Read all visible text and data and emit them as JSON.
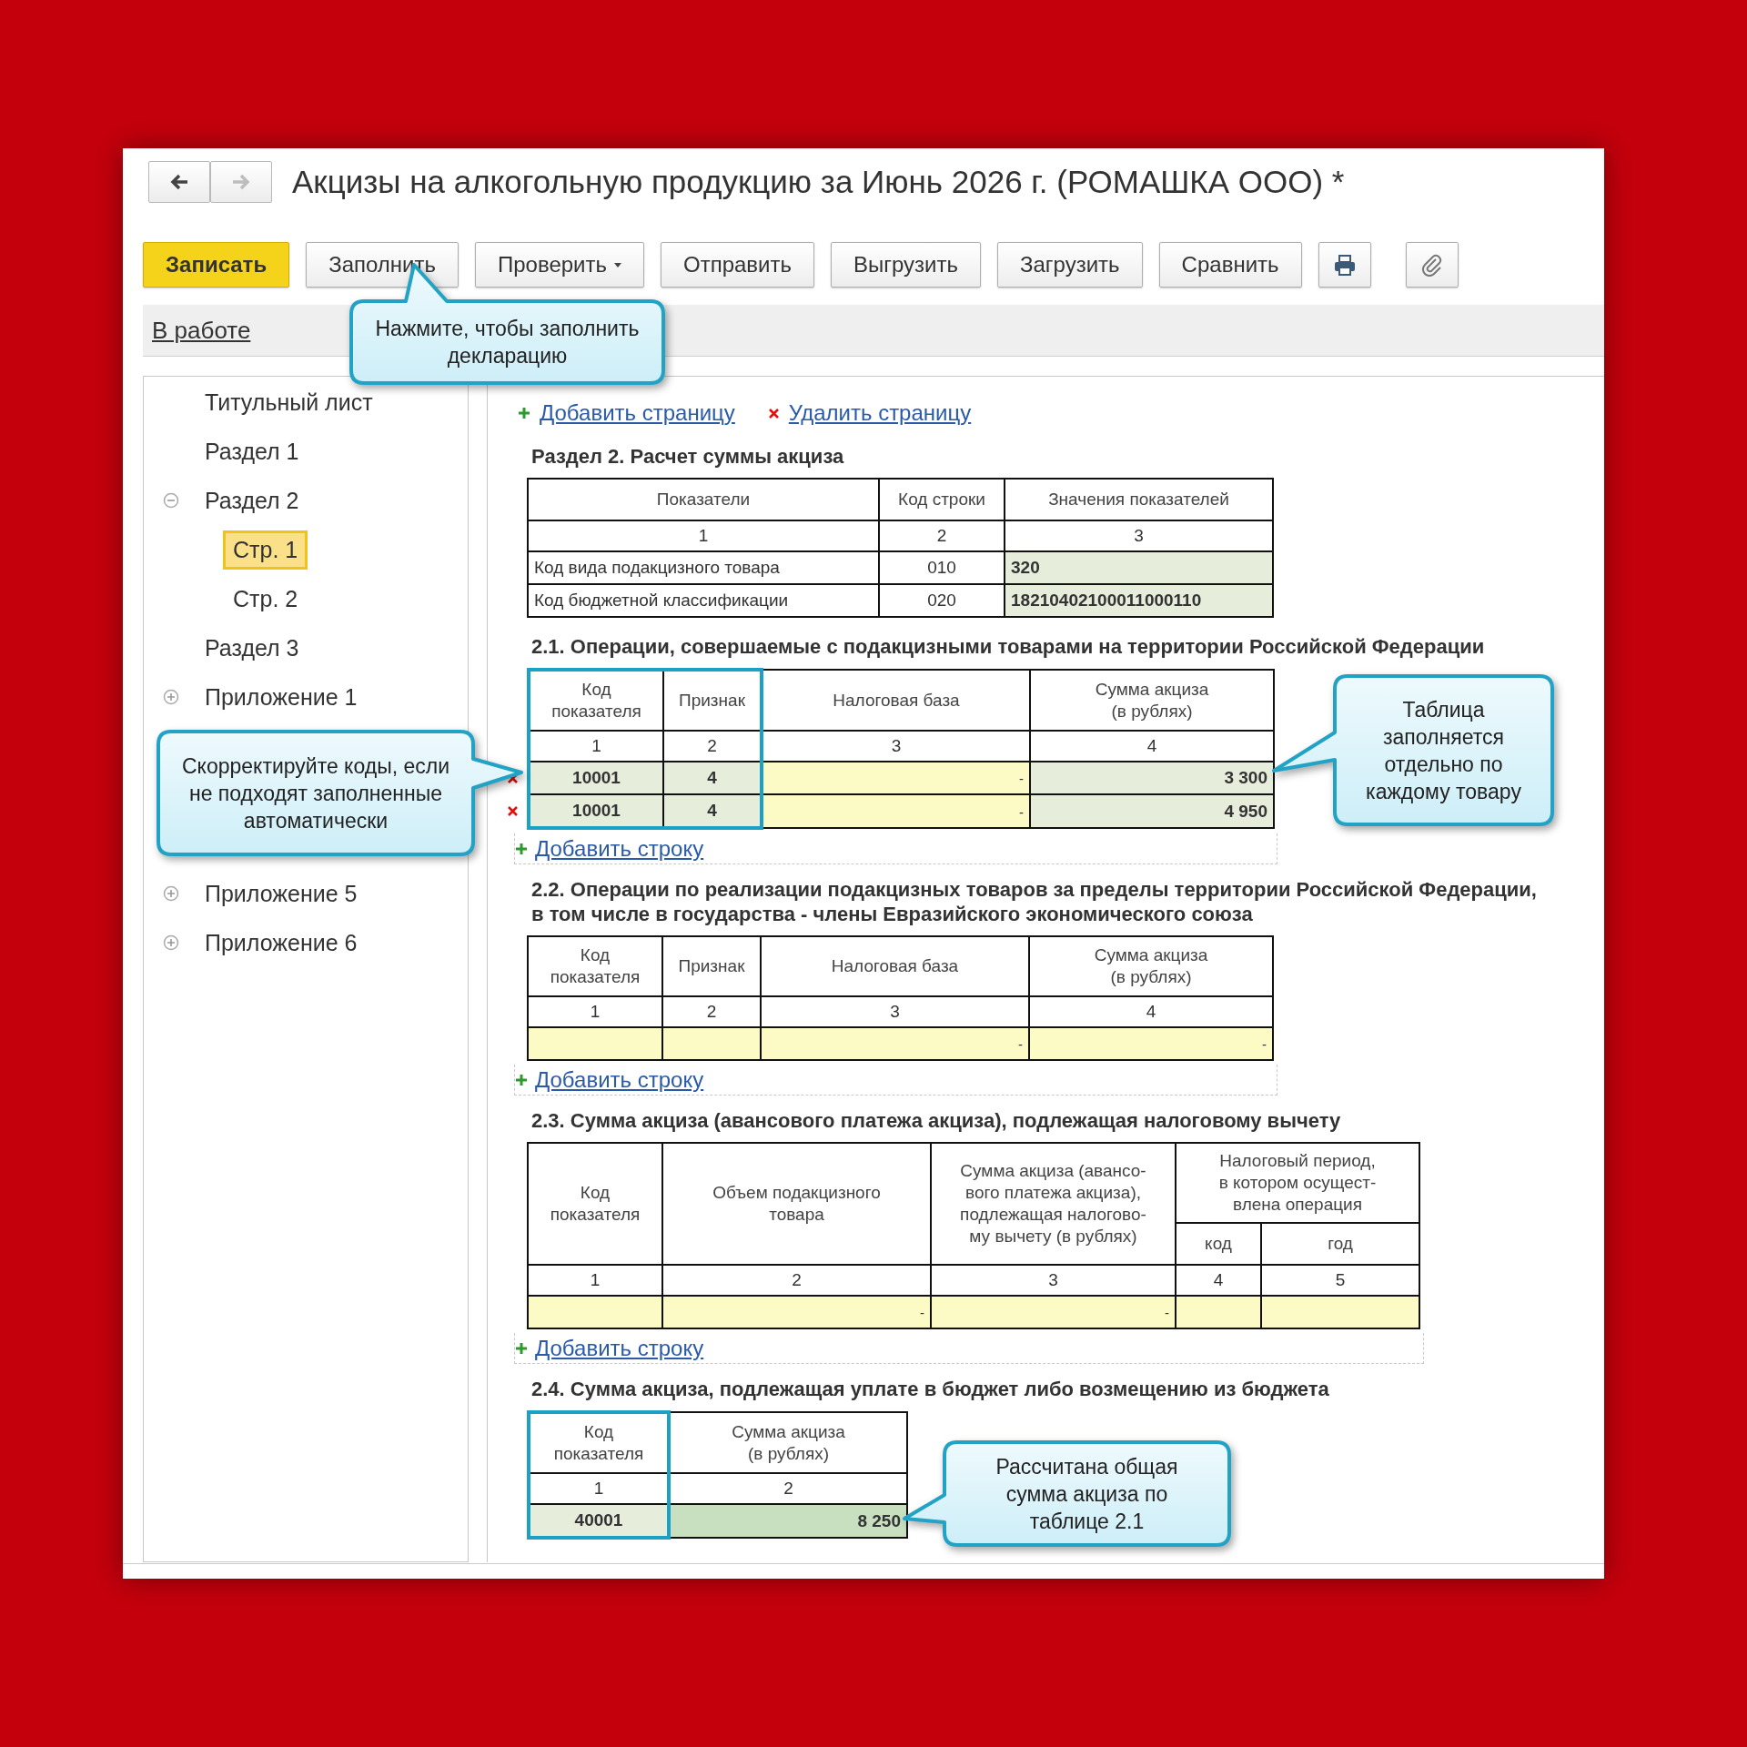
{
  "window": {
    "title": "Акцизы на алкогольную продукцию за Июнь 2026 г. (РОМАШКА ООО) *"
  },
  "nav": [
    {
      "kind": "back",
      "disabled": false
    },
    {
      "kind": "forward",
      "disabled": true
    }
  ],
  "toolbar": [
    {
      "kind": "primary",
      "label": "Записать"
    },
    {
      "kind": "button",
      "label": "Заполнить"
    },
    {
      "kind": "dropdown",
      "label": "Проверить"
    },
    {
      "kind": "button",
      "label": "Отправить"
    },
    {
      "kind": "button",
      "label": "Выгрузить"
    },
    {
      "kind": "button",
      "label": "Загрузить"
    },
    {
      "kind": "button",
      "label": "Сравнить"
    },
    {
      "kind": "print"
    },
    {
      "kind": "attach"
    }
  ],
  "status_link": "В работе",
  "tree": [
    {
      "label": "Титульный лист",
      "selected": false
    },
    {
      "label": "Раздел 1",
      "selected": false
    },
    {
      "label": "Раздел 2",
      "selected": false,
      "expanded": true,
      "children": [
        {
          "label": "Стр. 1",
          "selected": true
        },
        {
          "label": "Стр. 2",
          "selected": false
        }
      ]
    },
    {
      "label": "Раздел 3",
      "selected": false
    },
    {
      "label": "Приложение 1",
      "selected": false,
      "expanded": false
    },
    {
      "label": "Приложение 5",
      "selected": false,
      "expanded": false
    },
    {
      "label": "Приложение 6",
      "selected": false,
      "expanded": false
    }
  ],
  "page_actions": [
    {
      "kind": "add",
      "label": "Добавить страницу"
    },
    {
      "kind": "delete",
      "label": "Удалить страницу"
    }
  ],
  "sections": [
    {
      "heading": "Раздел 2. Расчет суммы акциза",
      "table": {
        "columns": [
          {
            "label": "Показатели",
            "highlighted": false
          },
          {
            "label": "Код строки",
            "highlighted": false
          },
          {
            "label": "Значения показателей",
            "highlighted": false
          }
        ],
        "numbers": [
          "1",
          "2",
          "3"
        ],
        "rows": [
          {
            "deletable": false,
            "cells": [
              {
                "kind": "plain",
                "value": "Код вида подакцизного товара"
              },
              {
                "kind": "plain",
                "value": "010"
              },
              {
                "kind": "auto",
                "value": "320"
              }
            ]
          },
          {
            "deletable": false,
            "cells": [
              {
                "kind": "plain",
                "value": "Код бюджетной классификации"
              },
              {
                "kind": "plain",
                "value": "020"
              },
              {
                "kind": "auto",
                "value": "18210402100011000110"
              }
            ]
          }
        ]
      }
    },
    {
      "heading": "2.1. Операции, совершаемые с подакцизными товарами на территории Российской Федерации",
      "add_row": "Добавить строку",
      "table": {
        "columns": [
          {
            "label": "Код\nпоказателя",
            "highlighted": true
          },
          {
            "label": "Признак",
            "highlighted": true
          },
          {
            "label": "Налоговая база",
            "highlighted": false
          },
          {
            "label": "Сумма акциза\n(в рублях)",
            "highlighted": false
          }
        ],
        "numbers": [
          "1",
          "2",
          "3",
          "4"
        ],
        "rows": [
          {
            "deletable": true,
            "cells": [
              {
                "kind": "auto",
                "value": "10001"
              },
              {
                "kind": "auto",
                "value": "4"
              },
              {
                "kind": "input",
                "value": "-"
              },
              {
                "kind": "auto",
                "value": "3 300"
              }
            ]
          },
          {
            "deletable": true,
            "cells": [
              {
                "kind": "auto",
                "value": "10001"
              },
              {
                "kind": "auto",
                "value": "4"
              },
              {
                "kind": "input",
                "value": "-"
              },
              {
                "kind": "auto",
                "value": "4 950"
              }
            ]
          }
        ]
      }
    },
    {
      "heading": "2.2. Операции по реализации подакцизных товаров за пределы территории Российской Федерации,\nв том числе в государства - члены Евразийского экономического союза",
      "add_row": "Добавить строку",
      "table": {
        "columns": [
          {
            "label": "Код\nпоказателя",
            "highlighted": false
          },
          {
            "label": "Признак",
            "highlighted": false
          },
          {
            "label": "Налоговая база",
            "highlighted": false
          },
          {
            "label": "Сумма акциза\n(в рублях)",
            "highlighted": false
          }
        ],
        "numbers": [
          "1",
          "2",
          "3",
          "4"
        ],
        "rows": [
          {
            "deletable": false,
            "cells": [
              {
                "kind": "input"
              },
              {
                "kind": "input"
              },
              {
                "kind": "input",
                "value": "-"
              },
              {
                "kind": "input",
                "value": "-"
              }
            ]
          }
        ]
      }
    },
    {
      "heading": "2.3. Сумма акциза (авансового платежа акциза), подлежащая налоговому вычету",
      "add_row": "Добавить строку",
      "table": {
        "columns": [
          {
            "label": "Код\nпоказателя",
            "highlighted": false
          },
          {
            "label": "Объем подакцизного\nтовара",
            "highlighted": false
          },
          {
            "label": "Сумма акциза (авансо-\nвого платежа акциза),\nподлежащая налогово-\nму вычету (в рублях)",
            "highlighted": false
          },
          {
            "label": "Налоговый период,\nв котором осущест-\nвлена операция",
            "highlighted": false,
            "children": [
              {
                "label": "код"
              },
              {
                "label": "год"
              }
            ]
          }
        ],
        "numbers": [
          "1",
          "2",
          "3",
          "4",
          "5"
        ],
        "rows": [
          {
            "deletable": false,
            "cells": [
              {
                "kind": "input"
              },
              {
                "kind": "input",
                "value": "-"
              },
              {
                "kind": "input",
                "value": "-"
              },
              {
                "kind": "input"
              },
              {
                "kind": "input"
              }
            ]
          }
        ]
      }
    },
    {
      "heading": "2.4. Сумма акциза, подлежащая уплате в бюджет либо возмещению из бюджета",
      "table": {
        "columns": [
          {
            "label": "Код\nпоказателя",
            "highlighted": true
          },
          {
            "label": "Сумма акциза\n(в рублях)",
            "highlighted": false
          }
        ],
        "numbers": [
          "1",
          "2"
        ],
        "rows": [
          {
            "deletable": false,
            "cells": [
              {
                "kind": "auto",
                "value": "40001"
              },
              {
                "kind": "total",
                "value": "8 250"
              }
            ]
          }
        ]
      }
    }
  ],
  "callouts": [
    {
      "kind": "fill",
      "text": "Нажмите, чтобы заполнить\nдекларацию"
    },
    {
      "kind": "codes",
      "text": "Скорректируйте коды, если\nне подходят заполненные\nавтоматически"
    },
    {
      "kind": "table",
      "text": "Таблица\nзаполняется\nотдельно по\nкаждому товару"
    },
    {
      "kind": "total",
      "text": "Рассчитана общая\nсумма акциза по\nтаблице 2.1"
    }
  ]
}
